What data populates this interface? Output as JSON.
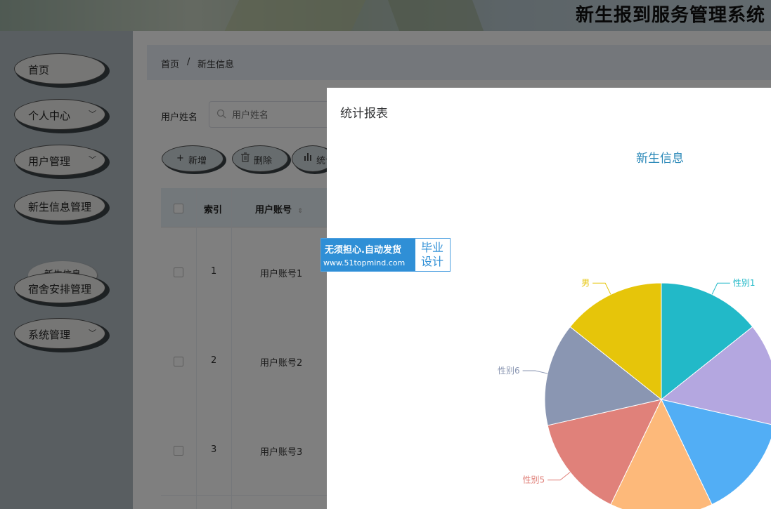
{
  "header": {
    "title": "新生报到服务管理系统"
  },
  "sidebar": {
    "items": [
      {
        "label": "首页",
        "has_children": false
      },
      {
        "label": "个人中心",
        "has_children": true
      },
      {
        "label": "用户管理",
        "has_children": true
      },
      {
        "label": "新生信息管理",
        "has_children": false
      },
      {
        "label": "宿舍安排管理",
        "has_children": false
      },
      {
        "label": "系统管理",
        "has_children": true
      }
    ],
    "submenu": {
      "label": "新生信息"
    }
  },
  "breadcrumb": {
    "home": "首页",
    "separator": "/",
    "current": "新生信息"
  },
  "search": {
    "label": "用户姓名",
    "placeholder": "用户姓名"
  },
  "toolbar": {
    "add_label": "新增",
    "delete_label": "删除",
    "stats_label": "统计"
  },
  "table": {
    "columns": [
      "索引",
      "用户账号"
    ],
    "rows": [
      {
        "index": "1",
        "account": "用户账号1"
      },
      {
        "index": "2",
        "account": "用户账号2"
      },
      {
        "index": "3",
        "account": "用户账号3"
      }
    ]
  },
  "dialog": {
    "title": "统计报表"
  },
  "chart_data": {
    "type": "pie",
    "title": "新生信息",
    "slices": [
      {
        "name": "性别1",
        "value": 1,
        "color": "#22b9c8",
        "label_shown": true
      },
      {
        "name": "",
        "value": 1,
        "color": "#b4a7e0",
        "label_shown": false
      },
      {
        "name": "",
        "value": 1,
        "color": "#52aef5",
        "label_shown": false
      },
      {
        "name": "",
        "value": 1,
        "color": "#fdb97a",
        "label_shown": false
      },
      {
        "name": "性别5",
        "value": 1,
        "color": "#e0817a",
        "label_shown": true
      },
      {
        "name": "性别6",
        "value": 1,
        "color": "#8a96b2",
        "label_shown": true
      },
      {
        "name": "男",
        "value": 1,
        "color": "#e6c50a",
        "label_shown": true
      }
    ]
  },
  "watermark": {
    "line1": "无须担心.自动发货",
    "line2": "www.51topmind.com",
    "right": "毕业设计"
  }
}
